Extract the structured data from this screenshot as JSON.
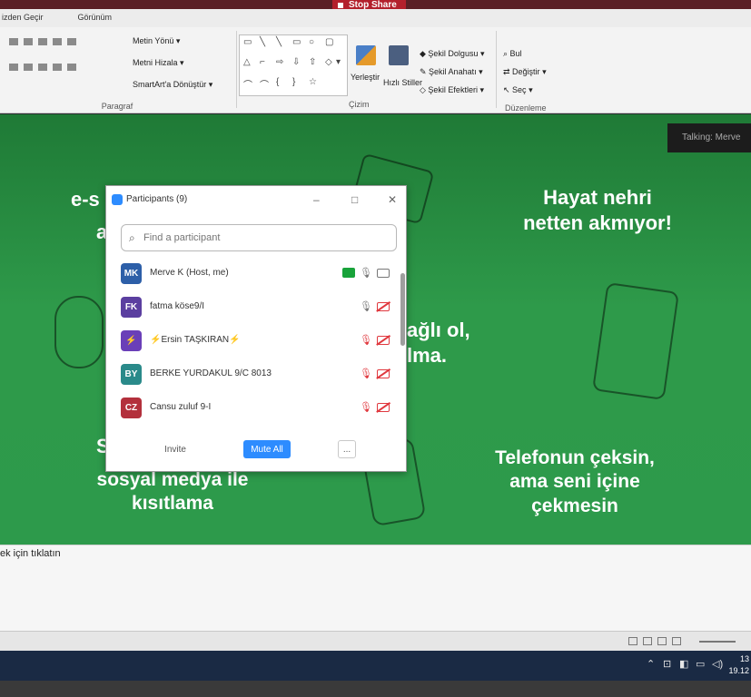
{
  "colors": {
    "slide_green": "#2d9a4b",
    "zoom_blue": "#2d8cff",
    "stop_share_red": "#b3202c",
    "muted_red": "#e0383e"
  },
  "share": {
    "stop_label": "Stop Share"
  },
  "ribbon": {
    "tabs": [
      "izden Geçir",
      "Görünüm"
    ],
    "paragraph": {
      "text_direction": "Metin Yönü",
      "align_text": "Metni Hizala",
      "convert_smartart": "SmartArt'a Dönüştür",
      "label": "Paragraf"
    },
    "drawing": {
      "arrange": "Yerleştir",
      "quick_styles": "Hızlı Stiller",
      "shape_fill": "Şekil Dolgusu",
      "shape_outline": "Şekil Anahatı",
      "shape_effects": "Şekil Efektleri",
      "label": "Çizim"
    },
    "editing": {
      "find": "Bul",
      "replace": "Değiştir",
      "select": "Seç",
      "label": "Düzenleme"
    }
  },
  "slide": {
    "top_left_fragment": "e-s",
    "top_left_fragment2": "a",
    "top_right_line1": "Hayat nehri",
    "top_right_line2": "netten akmıyor!",
    "mid_line1": "ağlı ol,",
    "mid_line2": "lma.",
    "bottom_left_fragment": "S",
    "bottom_left_line1": "sosyal medya ile",
    "bottom_left_line2": "kısıtlama",
    "bottom_right_line1": "Telefonun çeksin,",
    "bottom_right_line2": "ama seni içine",
    "bottom_right_line3": "çekmesin",
    "talking": "Talking: Merve"
  },
  "participants_window": {
    "title": "Participants (9)",
    "search_placeholder": "Find a participant",
    "invite_label": "Invite",
    "mute_all_label": "Mute All",
    "more_label": "...",
    "scroll_fraction": 0.2,
    "participants": [
      {
        "initials": "MK",
        "name": "Merve K (Host, me)",
        "color": "#2d5fa8",
        "mic": "on",
        "video": "on",
        "sharing": true
      },
      {
        "initials": "FK",
        "name": "fatma köse9/I",
        "color": "#5b3fa0",
        "mic": "on",
        "video": "off",
        "sharing": false
      },
      {
        "initials": "⚡",
        "name": "⚡Ersin TAŞKIRAN⚡",
        "color": "#6a3fb8",
        "mic": "muted",
        "video": "off",
        "sharing": false
      },
      {
        "initials": "BY",
        "name": "BERKE YURDAKUL 9/C 8013",
        "color": "#2a8a8a",
        "mic": "muted",
        "video": "off",
        "sharing": false
      },
      {
        "initials": "CZ",
        "name": "Cansu zuluf 9-I",
        "color": "#b3303c",
        "mic": "muted",
        "video": "off",
        "sharing": false
      }
    ]
  },
  "notes": {
    "placeholder": "ek için tıklatın"
  },
  "taskbar": {
    "clock_line1": "13",
    "clock_line2": "19.12"
  }
}
